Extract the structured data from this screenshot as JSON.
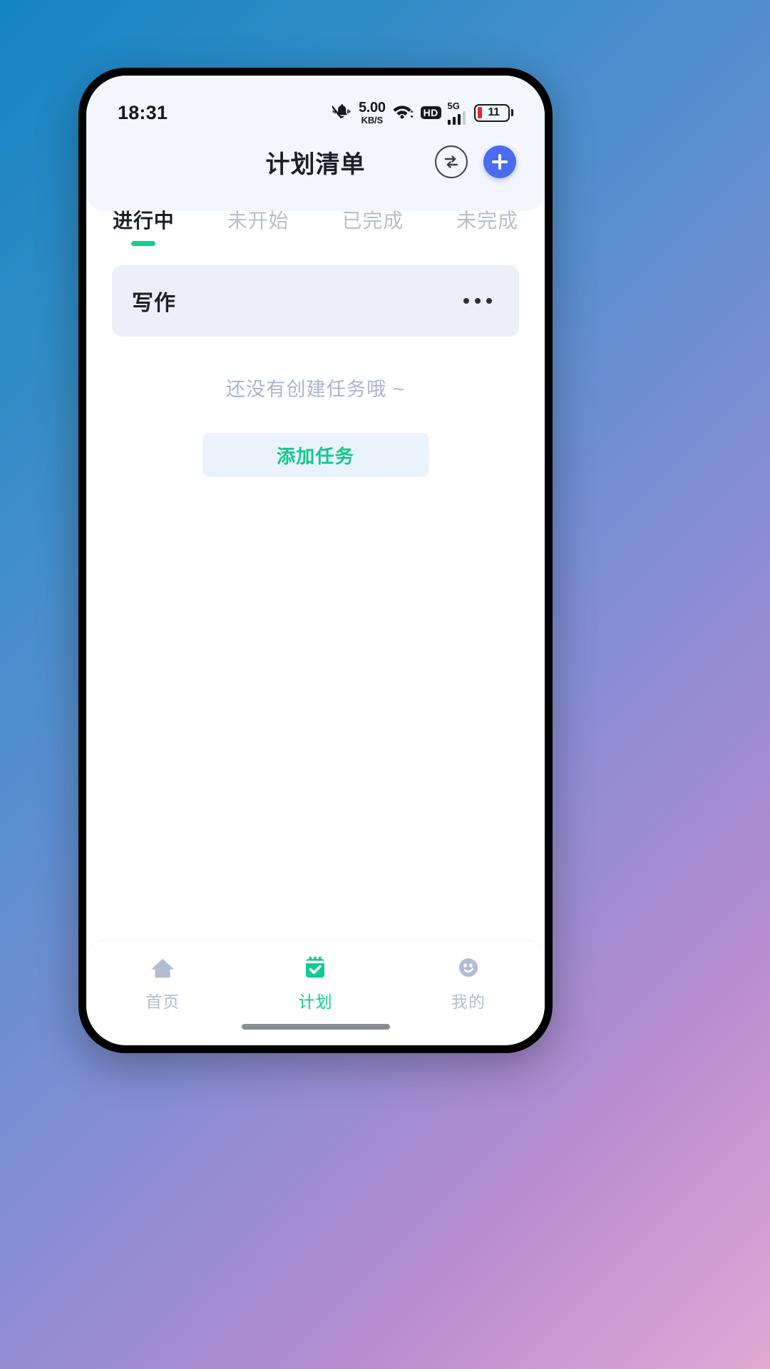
{
  "status_bar": {
    "time": "18:31",
    "mute_icon": "bell-muted-icon",
    "net_speed_value": "5.00",
    "net_speed_unit": "KB/S",
    "wifi_icon": "wifi-icon",
    "hd_label": "HD",
    "network_generation": "5G",
    "signal_icon": "signal-bars-icon",
    "battery_level": "11",
    "battery_color": "#f0252b"
  },
  "header": {
    "title": "计划清单",
    "sync_icon": "sync-swap-icon",
    "add_icon": "plus-icon",
    "add_button_color": "#4a6cf0"
  },
  "tabs": {
    "active_index": 0,
    "active_color": "#0fd08a",
    "items": [
      {
        "label": "进行中"
      },
      {
        "label": "未开始"
      },
      {
        "label": "已完成"
      },
      {
        "label": "未完成"
      }
    ]
  },
  "plan_card": {
    "title": "写作",
    "more_icon": "more-horizontal-icon"
  },
  "empty_state": {
    "message": "还没有创建任务哦 ~",
    "button_label": "添加任务",
    "button_text_color": "#12c98a",
    "button_bg_color": "#eaf3fc"
  },
  "bottom_nav": {
    "active_index": 1,
    "active_color": "#0fcb92",
    "inactive_color": "#b2bdd4",
    "items": [
      {
        "label": "首页",
        "icon": "home-icon"
      },
      {
        "label": "计划",
        "icon": "calendar-check-icon"
      },
      {
        "label": "我的",
        "icon": "smiley-face-icon"
      }
    ]
  }
}
